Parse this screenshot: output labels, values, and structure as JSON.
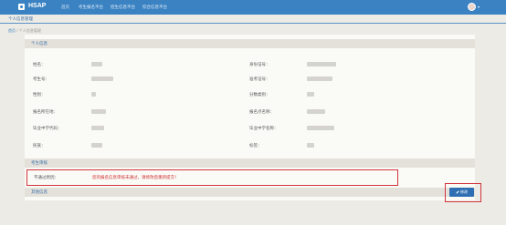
{
  "header": {
    "brand": "HSAP",
    "nav": [
      "首页",
      "考生报名平台",
      "招生信息平台",
      "综合信息平台"
    ],
    "user_caret": "▾"
  },
  "page_title": "个人信息管理",
  "breadcrumb": {
    "home": "首页",
    "separator": "/",
    "current": "个人信息管理"
  },
  "sections": {
    "personal": "个人信息",
    "review": "考生审核",
    "extra": "其他信息"
  },
  "fields": {
    "name_label": "姓名：",
    "name_value": "",
    "id_label": "身份证号：",
    "id_value": "",
    "exam_no_label": "考生号：",
    "exam_no_value": "",
    "admit_no_label": "准考证号：",
    "admit_no_value": "",
    "gender_label": "性别：",
    "gender_value": "",
    "category_label": "分数类别：",
    "category_value": "",
    "exam_city_label": "报名所在地：",
    "exam_city_value": "",
    "exam_area_label": "报名点名称：",
    "exam_area_value": "",
    "school_code_label": "毕业中学代码：",
    "school_code_value": "",
    "school_name_label": "毕业中学名称：",
    "school_name_value": "",
    "nation_label": "民族：",
    "nation_value": "",
    "tag_label": "标签：",
    "tag_value": ""
  },
  "review": {
    "label": "不通过原因：",
    "text": "您的报名信息审核未通过，请修改后重新提交！"
  },
  "modify_button": "修改",
  "colors": {
    "header_blue": "#3a82c2",
    "highlight_red": "#d3343c",
    "button_blue": "#2e6fb3"
  }
}
